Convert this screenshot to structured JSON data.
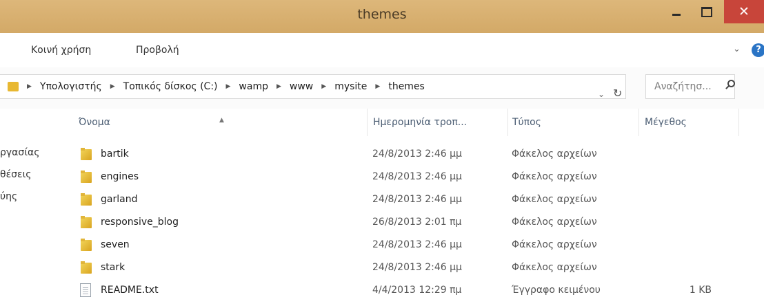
{
  "window": {
    "title": "themes",
    "controls": {
      "minimize_icon": "minimize-icon",
      "maximize_icon": "maximize-icon",
      "close_icon": "close-icon",
      "close_glyph": "✕"
    }
  },
  "ribbon": {
    "tabs": [
      {
        "label": "Κοινή χρήση"
      },
      {
        "label": "Προβολή"
      }
    ],
    "expand_glyph": "⌄",
    "help_glyph": "?"
  },
  "address": {
    "crumbs": [
      {
        "label": "Υπολογιστής"
      },
      {
        "label": "Τοπικός δίσκος (C:)"
      },
      {
        "label": "wamp"
      },
      {
        "label": "www"
      },
      {
        "label": "mysite"
      },
      {
        "label": "themes"
      }
    ],
    "separator_glyph": "▶",
    "dropdown_glyph": "⌄",
    "refresh_glyph": "↻"
  },
  "search": {
    "placeholder": "Αναζήτησ..."
  },
  "nav": {
    "items": [
      {
        "label": "ργασίας"
      },
      {
        "label": "θέσεις"
      },
      {
        "label": "ύης"
      }
    ]
  },
  "columns": {
    "name": "Όνομα",
    "date": "Ημερομηνία τροπ...",
    "type": "Τύπος",
    "size": "Μέγεθος",
    "sort_glyph": "▲"
  },
  "files": [
    {
      "name": "bartik",
      "date": "24/8/2013 2:46 μμ",
      "type": "Φάκελος αρχείων",
      "size": "",
      "kind": "folder"
    },
    {
      "name": "engines",
      "date": "24/8/2013 2:46 μμ",
      "type": "Φάκελος αρχείων",
      "size": "",
      "kind": "folder"
    },
    {
      "name": "garland",
      "date": "24/8/2013 2:46 μμ",
      "type": "Φάκελος αρχείων",
      "size": "",
      "kind": "folder"
    },
    {
      "name": "responsive_blog",
      "date": "26/8/2013 2:01 πμ",
      "type": "Φάκελος αρχείων",
      "size": "",
      "kind": "folder"
    },
    {
      "name": "seven",
      "date": "24/8/2013 2:46 μμ",
      "type": "Φάκελος αρχείων",
      "size": "",
      "kind": "folder"
    },
    {
      "name": "stark",
      "date": "24/8/2013 2:46 μμ",
      "type": "Φάκελος αρχείων",
      "size": "",
      "kind": "folder"
    },
    {
      "name": "README.txt",
      "date": "4/4/2013 12:29 πμ",
      "type": "Έγγραφο κειμένου",
      "size": "1 KB",
      "kind": "file"
    }
  ]
}
